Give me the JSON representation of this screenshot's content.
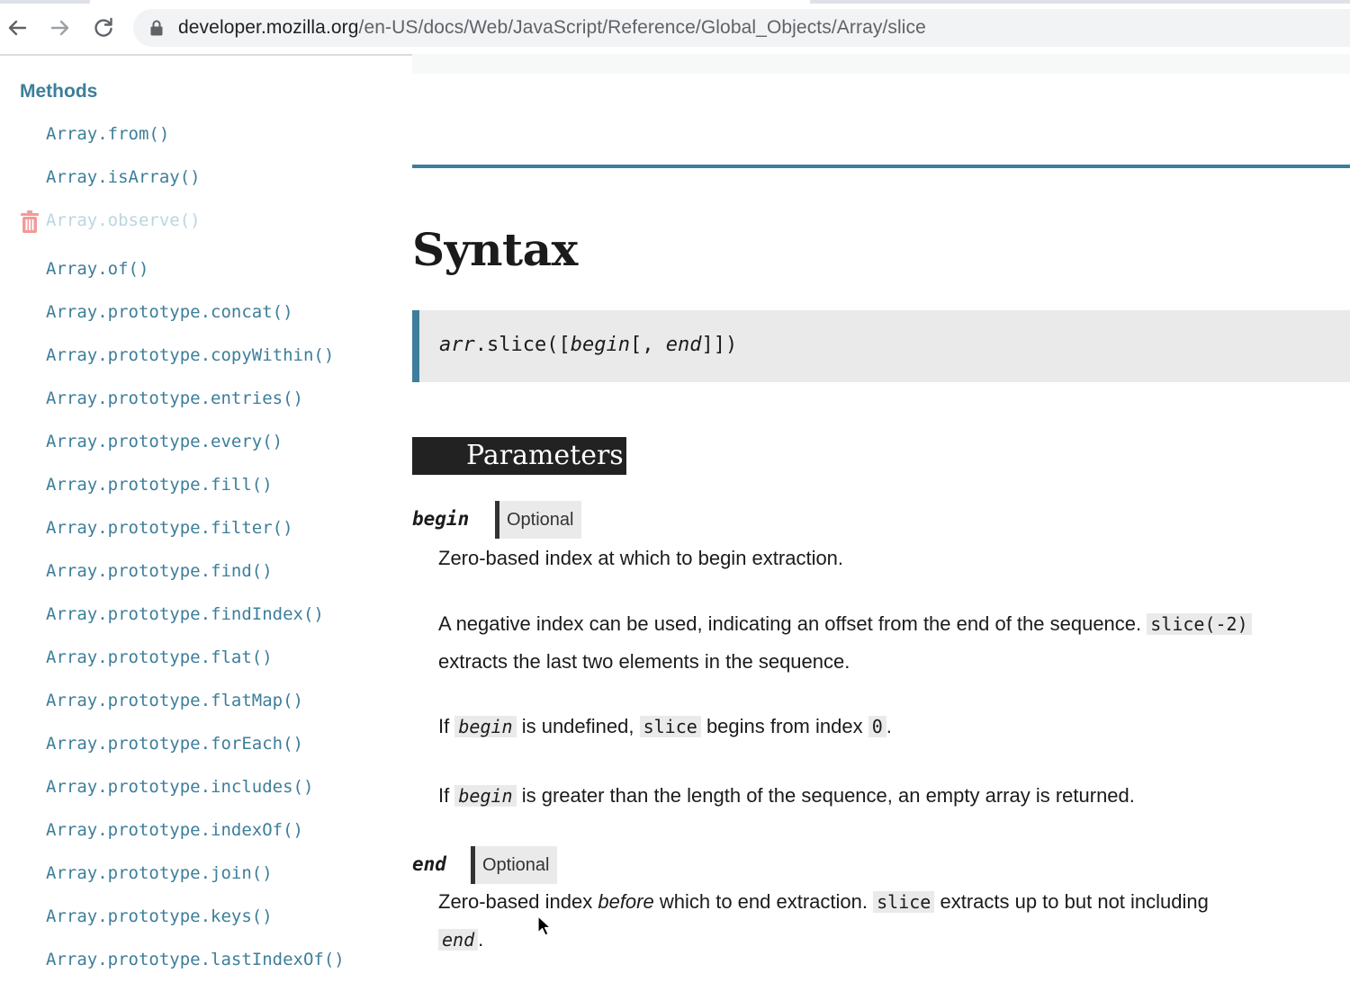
{
  "browser": {
    "url_host": "developer.mozilla.org",
    "url_path": "/en-US/docs/Web/JavaScript/Reference/Global_Objects/Array/slice"
  },
  "sidebar": {
    "heading": "Methods",
    "items": [
      {
        "label": "Array.from()",
        "obsolete": false
      },
      {
        "label": "Array.isArray()",
        "obsolete": false
      },
      {
        "label": "Array.observe()",
        "obsolete": true
      },
      {
        "label": "Array.of()",
        "obsolete": false
      },
      {
        "label": "Array.prototype.concat()",
        "obsolete": false
      },
      {
        "label": "Array.prototype.copyWithin()",
        "obsolete": false
      },
      {
        "label": "Array.prototype.entries()",
        "obsolete": false
      },
      {
        "label": "Array.prototype.every()",
        "obsolete": false
      },
      {
        "label": "Array.prototype.fill()",
        "obsolete": false
      },
      {
        "label": "Array.prototype.filter()",
        "obsolete": false
      },
      {
        "label": "Array.prototype.find()",
        "obsolete": false
      },
      {
        "label": "Array.prototype.findIndex()",
        "obsolete": false
      },
      {
        "label": "Array.prototype.flat()",
        "obsolete": false
      },
      {
        "label": "Array.prototype.flatMap()",
        "obsolete": false
      },
      {
        "label": "Array.prototype.forEach()",
        "obsolete": false
      },
      {
        "label": "Array.prototype.includes()",
        "obsolete": false
      },
      {
        "label": "Array.prototype.indexOf()",
        "obsolete": false
      },
      {
        "label": "Array.prototype.join()",
        "obsolete": false
      },
      {
        "label": "Array.prototype.keys()",
        "obsolete": false
      },
      {
        "label": "Array.prototype.lastIndexOf()",
        "obsolete": false
      }
    ]
  },
  "main": {
    "syntax_title": "Syntax",
    "syntax": {
      "arr": "arr",
      "method": ".slice([",
      "begin": "begin",
      "sep": "[, ",
      "end": "end",
      "close": "]])"
    },
    "parameters_heading": "Parameters",
    "begin_param": {
      "name": "begin",
      "badge": "Optional",
      "p1": "Zero-based index at which to begin extraction.",
      "p2a": "A negative index can be used, indicating an offset from the end of the sequence.",
      "p2code": "slice(-2)",
      "p2b": "extracts the last two elements in the sequence.",
      "p3a": "If",
      "p3code1": "begin",
      "p3b": "is undefined,",
      "p3code2": "slice",
      "p3c": "begins from index",
      "p3code3": "0",
      "p3d": ".",
      "p4a": "If",
      "p4code": "begin",
      "p4b": "is greater than the length of the sequence, an empty array is returned."
    },
    "end_param": {
      "name": "end",
      "badge": "Optional",
      "p1a": "Zero-based index",
      "p1em": "before",
      "p1b": "which to end extraction.",
      "p1code": "slice",
      "p1c": "extracts up to but not including",
      "p1code2": "end",
      "p1d": "."
    }
  },
  "colors": {
    "accent": "#3d7e9a",
    "code_bg": "#eaeaea",
    "heading_bar": "#222222"
  },
  "icons": [
    "back-arrow-icon",
    "forward-arrow-icon",
    "reload-icon",
    "lock-icon",
    "trash-icon",
    "mouse-cursor-icon"
  ]
}
